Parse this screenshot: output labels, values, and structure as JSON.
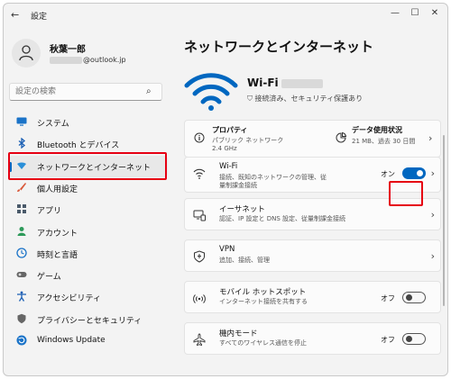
{
  "window": {
    "back_glyph": "←",
    "title": "設定",
    "controls": [
      "—",
      "☐",
      "✕"
    ]
  },
  "user": {
    "name": "秋葉一郎",
    "email_suffix": "@outlook.jp"
  },
  "search": {
    "placeholder": "設定の検索"
  },
  "sidebar": {
    "items": [
      {
        "label": "システム",
        "icon": "monitor-icon",
        "color": "#1a73c8"
      },
      {
        "label": "Bluetooth とデバイス",
        "icon": "bluetooth-icon",
        "color": "#1a5fb4"
      },
      {
        "label": "ネットワークとインターネット",
        "icon": "wifi-diamond-icon",
        "color": "#2a8fd8",
        "active": true
      },
      {
        "label": "個人用設定",
        "icon": "brush-icon",
        "color": "#d9583a"
      },
      {
        "label": "アプリ",
        "icon": "apps-icon",
        "color": "#4a5a6a"
      },
      {
        "label": "アカウント",
        "icon": "person-icon",
        "color": "#2e9a5a"
      },
      {
        "label": "時刻と言語",
        "icon": "globe-clock-icon",
        "color": "#1a73c8"
      },
      {
        "label": "ゲーム",
        "icon": "gamepad-icon",
        "color": "#666666"
      },
      {
        "label": "アクセシビリティ",
        "icon": "accessibility-icon",
        "color": "#1a5fb4"
      },
      {
        "label": "プライバシーとセキュリティ",
        "icon": "shield-icon",
        "color": "#666666"
      },
      {
        "label": "Windows Update",
        "icon": "update-icon",
        "color": "#1a73c8"
      }
    ]
  },
  "main": {
    "title": "ネットワークとインターネット",
    "hero": {
      "name": "Wi-Fi",
      "status": "接続済み、セキュリティ保護あり"
    },
    "properties": {
      "title": "プロパティ",
      "network": "パブリック ネットワーク",
      "band": "2.4 GHz"
    },
    "data_usage": {
      "title": "データ使用状況",
      "detail": "21 MB、過去 30 日間"
    },
    "cards": [
      {
        "title": "Wi-Fi",
        "sub1": "接続、既知のネットワークの管理、従",
        "sub2": "量制課金接続",
        "state": "オン",
        "toggle": "on",
        "icon": "wifi-icon"
      },
      {
        "title": "イーサネット",
        "sub1": "認証、IP 設定と DNS 設定、従量制課金接続",
        "sub2": "",
        "state": "",
        "toggle": "",
        "icon": "ethernet-icon"
      },
      {
        "title": "VPN",
        "sub1": "追加、接続、管理",
        "sub2": "",
        "state": "",
        "toggle": "",
        "icon": "vpn-shield-icon"
      },
      {
        "title": "モバイル ホットスポット",
        "sub1": "インターネット接続を共有する",
        "sub2": "",
        "state": "オフ",
        "toggle": "off",
        "icon": "hotspot-icon"
      },
      {
        "title": "機内モード",
        "sub1": "すべてのワイヤレス通信を停止",
        "sub2": "",
        "state": "オフ",
        "toggle": "off",
        "icon": "airplane-icon"
      }
    ]
  },
  "colors": {
    "accent": "#0067c0",
    "highlight_box": "#e60012"
  }
}
